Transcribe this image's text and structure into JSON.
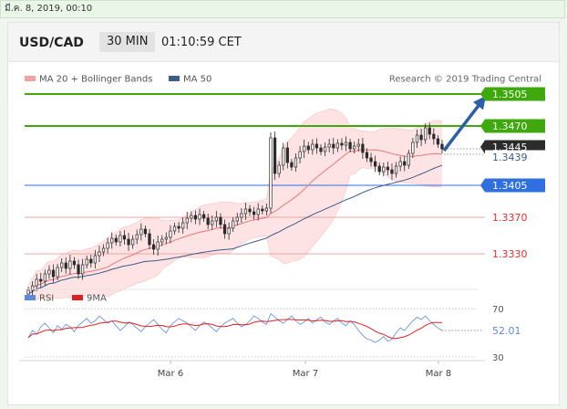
{
  "header": {
    "date": "มี.ค. 8, 2019, 00:10",
    "pair": "USD/CAD",
    "timeframe": "30 MIN",
    "time": "01:10:59 CET"
  },
  "legend": {
    "ma20": "MA 20 + Bollinger Bands",
    "ma50": "MA 50",
    "credit": "Research © 2019 Trading Central",
    "rsi": "RSI",
    "rsi_ma": "9MA"
  },
  "colors": {
    "candle": "#2a2a2a",
    "band_fill": "#fde0e0",
    "band_line": "#f3a0a0",
    "ma20": "#e87878",
    "ma50": "#3d5b8c",
    "resistance": "#3ea80d",
    "support_blue": "#2f6fe0",
    "support_red": "#e03030",
    "arrow": "#2b5fa8",
    "rsi": "#5a8ae0",
    "rsi_ma": "#e02020"
  },
  "chart_data": [
    {
      "type": "candlestick",
      "title": "USD/CAD",
      "x_labels": [
        "Mar 6",
        "Mar 7",
        "Mar 8"
      ],
      "ylim": [
        1.33,
        1.3525
      ],
      "last_price": 1.3445,
      "series": [
        {
          "name": "MA 20 + Bollinger Bands",
          "last": 1.3439
        },
        {
          "name": "MA 50"
        }
      ],
      "levels": [
        {
          "value": 1.3505,
          "label": "1.3505",
          "kind": "resistance",
          "style": "green"
        },
        {
          "value": 1.347,
          "label": "1.3470",
          "kind": "resistance",
          "style": "green"
        },
        {
          "value": 1.3445,
          "label": "1.3445",
          "kind": "last",
          "style": "dark"
        },
        {
          "value": 1.3439,
          "label": "1.3439",
          "kind": "ma",
          "style": "ma"
        },
        {
          "value": 1.3405,
          "label": "1.3405",
          "kind": "pivot",
          "style": "blue"
        },
        {
          "value": 1.337,
          "label": "1.3370",
          "kind": "support",
          "style": "red"
        },
        {
          "value": 1.333,
          "label": "1.3330",
          "kind": "support",
          "style": "red"
        }
      ],
      "closes": [
        1.329,
        1.3295,
        1.3302,
        1.33,
        1.3308,
        1.3312,
        1.3305,
        1.3315,
        1.332,
        1.3314,
        1.3322,
        1.3318,
        1.3308,
        1.3318,
        1.3324,
        1.332,
        1.3328,
        1.3332,
        1.3336,
        1.3342,
        1.3347,
        1.3343,
        1.335,
        1.3346,
        1.334,
        1.3346,
        1.3351,
        1.3357,
        1.3352,
        1.334,
        1.3335,
        1.3343,
        1.3346,
        1.3348,
        1.3355,
        1.336,
        1.3358,
        1.3364,
        1.3369,
        1.3372,
        1.3368,
        1.3373,
        1.3369,
        1.3362,
        1.3366,
        1.337,
        1.3362,
        1.3352,
        1.3358,
        1.3366,
        1.337,
        1.3374,
        1.3379,
        1.3376,
        1.3373,
        1.3379,
        1.3377,
        1.338,
        1.3457,
        1.3418,
        1.3427,
        1.3446,
        1.343,
        1.3425,
        1.3435,
        1.3442,
        1.3448,
        1.3444,
        1.345,
        1.3446,
        1.3442,
        1.3447,
        1.345,
        1.3446,
        1.3451,
        1.3449,
        1.3452,
        1.3445,
        1.3448,
        1.345,
        1.3441,
        1.3435,
        1.3431,
        1.3426,
        1.342,
        1.3425,
        1.3422,
        1.3418,
        1.3426,
        1.3431,
        1.3427,
        1.344,
        1.3452,
        1.346,
        1.3455,
        1.3468,
        1.3461,
        1.3456,
        1.345,
        1.3445
      ],
      "ma20_last": 1.3439
    },
    {
      "type": "line",
      "title": "RSI",
      "ylim": [
        30,
        80
      ],
      "y_ticks": [
        70,
        30
      ],
      "last_value": 52.01,
      "series": [
        {
          "name": "RSI"
        },
        {
          "name": "9MA"
        }
      ],
      "rsi": [
        46,
        52,
        49,
        55,
        58,
        54,
        50,
        56,
        53,
        57,
        55,
        51,
        56,
        59,
        62,
        58,
        60,
        64,
        61,
        58,
        60,
        56,
        52,
        55,
        59,
        57,
        54,
        51,
        55,
        58,
        61,
        57,
        53,
        50,
        56,
        59,
        62,
        60,
        58,
        55,
        52,
        56,
        59,
        57,
        54,
        51,
        55,
        58,
        60,
        62,
        58,
        55,
        57,
        60,
        64,
        62,
        59,
        57,
        66,
        63,
        60,
        58,
        61,
        64,
        60,
        57,
        59,
        62,
        58,
        61,
        63,
        59,
        57,
        60,
        62,
        58,
        56,
        60,
        57,
        52,
        48,
        45,
        44,
        42,
        44,
        47,
        43,
        45,
        50,
        54,
        52,
        56,
        60,
        63,
        61,
        64,
        60,
        57,
        54,
        52.01
      ]
    }
  ]
}
